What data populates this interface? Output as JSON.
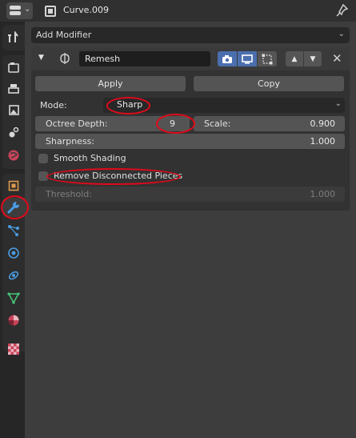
{
  "header": {
    "object_name": "Curve.009"
  },
  "toolbar": {
    "add_modifier_label": "Add Modifier"
  },
  "modifier": {
    "name": "Remesh",
    "apply_label": "Apply",
    "copy_label": "Copy",
    "mode_label": "Mode:",
    "mode_value": "Sharp",
    "octree_depth_label": "Octree Depth:",
    "octree_depth_value": "9",
    "scale_label": "Scale:",
    "scale_value": "0.900",
    "sharpness_label": "Sharpness:",
    "sharpness_value": "1.000",
    "smooth_shading_label": "Smooth Shading",
    "remove_disconnected_label": "Remove Disconnected Pieces",
    "threshold_label": "Threshold:",
    "threshold_value": "1.000"
  },
  "tabs": [
    "tool",
    "render",
    "output",
    "view-layer",
    "scene",
    "world",
    "object",
    "modifier",
    "particles",
    "physics",
    "constraints",
    "object-data",
    "material",
    "texture"
  ],
  "colors": {
    "accent_blue": "#4b6fae",
    "annotation_red": "#e2091a"
  }
}
